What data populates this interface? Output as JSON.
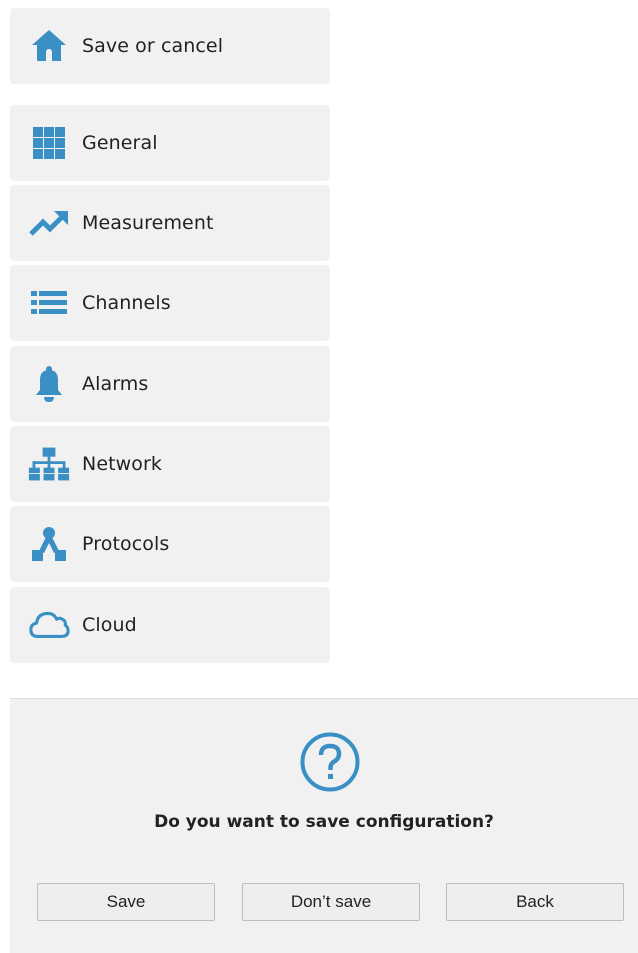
{
  "menu": {
    "top_item": {
      "label": "Save or cancel",
      "icon": "home-icon"
    },
    "items": [
      {
        "label": "General",
        "icon": "grid-icon"
      },
      {
        "label": "Measurement",
        "icon": "trend-up-icon"
      },
      {
        "label": "Channels",
        "icon": "list-icon"
      },
      {
        "label": "Alarms",
        "icon": "bell-icon"
      },
      {
        "label": "Network",
        "icon": "network-icon"
      },
      {
        "label": "Protocols",
        "icon": "protocols-icon"
      },
      {
        "label": "Cloud",
        "icon": "cloud-icon"
      }
    ]
  },
  "dialog": {
    "icon": "question-circle-icon",
    "question": "Do you want to save configuration?",
    "buttons": {
      "save": "Save",
      "dont_save": "Don’t save",
      "back": "Back"
    }
  },
  "colors": {
    "accent": "#3a8fc4",
    "panel_bg": "#f1f1f1",
    "button_bg": "#eeeeee",
    "text": "#222222"
  }
}
